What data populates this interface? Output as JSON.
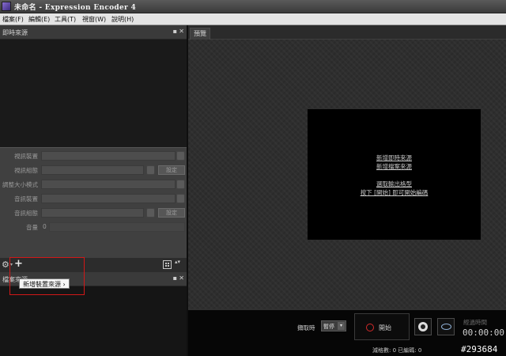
{
  "window": {
    "title": "未命名 - Expression Encoder 4"
  },
  "menu": [
    "檔案(F)",
    "編輯(E)",
    "工具(T)",
    "視窗(W)",
    "說明(H)"
  ],
  "live_panel": {
    "title": "即時來源",
    "pin": "▪",
    "close": "✕"
  },
  "properties": {
    "video_device": "視訊裝置",
    "video_config": "視訊組態",
    "resize_mode": "調整大小模式",
    "audio_device": "音訊裝置",
    "audio_config": "音訊組態",
    "volume": "音量",
    "volume_value": "0",
    "set_label": "設定"
  },
  "toolbar": {
    "gear": "⚙",
    "caret": "▾",
    "add": "+",
    "updown": "▴▾"
  },
  "tooltip": "新增裝置來源 ›",
  "file_panel": {
    "title": "檔案來源",
    "pin": "▪",
    "close": "✕"
  },
  "preview": {
    "tab": "預覽",
    "links": [
      "新增即時來源",
      "新增檔案來源",
      "",
      "選取輸出格型",
      "按下 [開始] 即可開始編碼"
    ]
  },
  "bottom": {
    "record_label": "擷取時",
    "record_value": "暫停",
    "start_label": "開始",
    "time_label": "經過時間",
    "time": "00:00:00",
    "stats": "減格數: 0 已編碼: 0",
    "watermark": "#293684"
  },
  "colors": {
    "highlight": "#d21818",
    "record_dot": "#d42a2a"
  }
}
